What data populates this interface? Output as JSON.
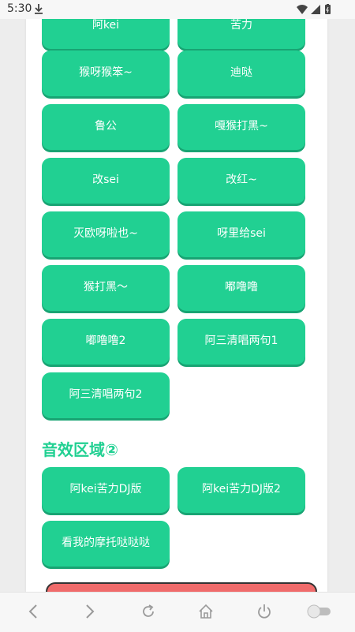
{
  "status_bar": {
    "time": "5:30"
  },
  "sound_buttons": [
    "阿kei",
    "苦力",
    "猴呀猴笨~",
    "迪哒",
    "鲁公",
    "嘎猴打黑~",
    "改sei",
    "改红~",
    "灭欧呀啦也~",
    "呀里给sei",
    "猴打黑〜",
    "嘟噜噜",
    "嘟噜噜2",
    "阿三清唱两句1",
    "阿三清唱两句2"
  ],
  "section2": {
    "title": "音效区域②",
    "buttons": [
      "阿kei苦力DJ版",
      "阿kei苦力DJ版2",
      "看我的摩托哒哒哒"
    ]
  },
  "colors": {
    "accent": "#21d092",
    "accent_shadow": "#18a473",
    "danger": "#f06b6b"
  }
}
